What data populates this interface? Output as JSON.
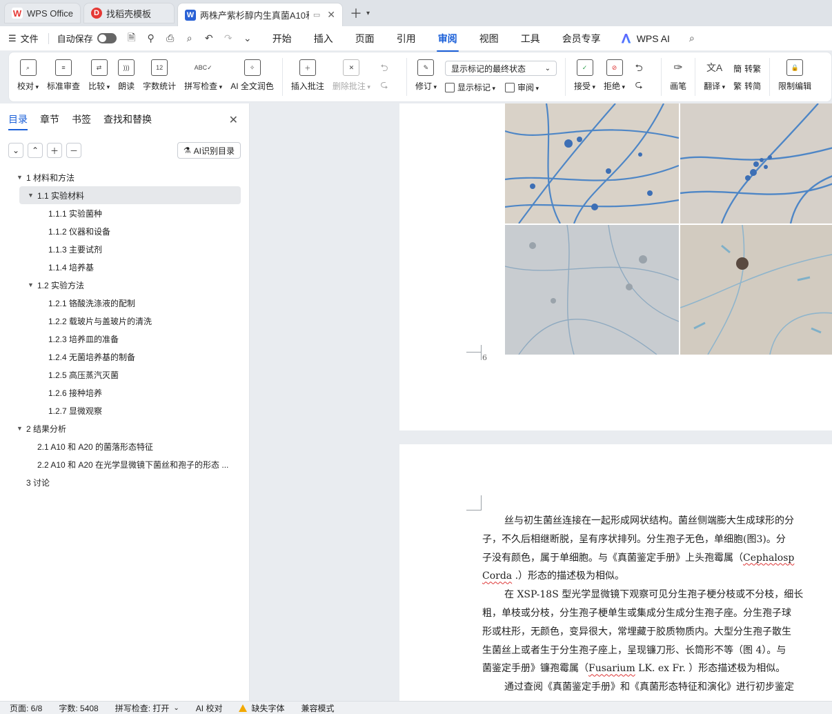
{
  "tabs": [
    {
      "label": "WPS Office",
      "icon": "wps-logo-icon",
      "color": "#e53935"
    },
    {
      "label": "找稻壳模板",
      "icon": "docer-icon",
      "color": "#e53935"
    },
    {
      "label": "两株产紫杉醇内生真菌A10和A",
      "icon": "word-doc-icon",
      "color": "#2a62d6",
      "active": true
    }
  ],
  "menubar": {
    "file": "文件",
    "autosave": "自动保存",
    "tabs": [
      "开始",
      "插入",
      "页面",
      "引用",
      "审阅",
      "视图",
      "工具",
      "会员专享"
    ],
    "active_tab": "审阅",
    "wps_ai": "WPS AI"
  },
  "ribbon": {
    "proof": "校对",
    "std_review": "标准审查",
    "compare": "比较",
    "read_aloud": "朗读",
    "word_count": "字数统计",
    "spell_check": "拼写检查",
    "ai_polish": "AI 全文润色",
    "insert_comment": "插入批注",
    "delete_comment": "删除批注",
    "track_changes": "修订",
    "display_state": "显示标记的最终状态",
    "show_markup": "显示标记",
    "review_pane": "审阅",
    "accept": "接受",
    "reject": "拒绝",
    "pen": "画笔",
    "translate": "翻译",
    "to_traditional": "转繁",
    "to_simplified": "转简",
    "restrict_edit": "限制编辑"
  },
  "nav": {
    "tabs": [
      "目录",
      "章节",
      "书签",
      "查找和替换"
    ],
    "active_tab": "目录",
    "ai_toc": "AI识别目录",
    "toc": [
      {
        "level": "l1",
        "text": "1 材料和方法",
        "caret": "▼"
      },
      {
        "level": "l2",
        "text": "1.1 实验材料",
        "caret": "▼",
        "selected": true
      },
      {
        "level": "l3",
        "text": "1.1.1 实验菌种"
      },
      {
        "level": "l3",
        "text": "1.1.2 仪器和设备"
      },
      {
        "level": "l3",
        "text": "1.1.3 主要试剂"
      },
      {
        "level": "l3",
        "text": "1.1.4 培养基"
      },
      {
        "level": "l2",
        "text": "1.2 实验方法",
        "caret": "▼"
      },
      {
        "level": "l3",
        "text": "1.2.1 铬酸洗涤液的配制"
      },
      {
        "level": "l3",
        "text": "1.2.2 载玻片与盖玻片的清洗"
      },
      {
        "level": "l3",
        "text": "1.2.3 培养皿的准备"
      },
      {
        "level": "l3",
        "text": "1.2.4 无菌培养基的制备"
      },
      {
        "level": "l3",
        "text": "1.2.5 高压蒸汽灭菌"
      },
      {
        "level": "l3",
        "text": "1.2.6 接种培养"
      },
      {
        "level": "l3",
        "text": "1.2.7 显微观察"
      },
      {
        "level": "l1",
        "text": "2 结果分析",
        "caret": "▼"
      },
      {
        "level": "l2n",
        "text": "2.1 A10 和 A20 的菌落形态特征"
      },
      {
        "level": "l2n",
        "text": "2.2 A10 和 A20 在光学显微镜下菌丝和孢子的形态 ..."
      },
      {
        "level": "l1n",
        "text": "3 讨论"
      }
    ]
  },
  "document": {
    "page_number": "6",
    "lines": [
      {
        "text": "丝与初生菌丝连接在一起形成网状结构。菌丝侧端膨大生成球形的分",
        "indent": true
      },
      {
        "text": "子，不久后相继断脱，呈有序状排列。分生孢子无色，单细胞(图3)。分"
      },
      {
        "text": "子没有颜色，属于单细胞。与《真菌鉴定手册》上头孢霉属（",
        "tail": "Cephalosp",
        "tail_squig": true
      },
      {
        "text": "",
        "head": "Corda",
        "head_squig": true,
        "rest": " .）形态的描述极为相似。"
      },
      {
        "text": "在 XSP-18S 型光学显微镜下观察可见分生孢子梗分枝或不分枝，细长",
        "indent": true
      },
      {
        "text": "粗，单枝或分枝，分生孢子梗单生或集成分生成分生孢子座。分生孢子球"
      },
      {
        "text": "形或柱形，无颜色，变异很大，常埋藏于胶质物质内。大型分生孢子散生"
      },
      {
        "text": "生菌丝上或者生于分生孢子座上，呈现镰刀形、长筒形不等（图 4）。与"
      },
      {
        "text": "菌鉴定手册》镰孢霉属（",
        "head": "Fusarium",
        "head_squig": true,
        "rest": " LK. ex Fr. ）形态描述极为相似。"
      },
      {
        "text": "通过查阅《真菌鉴定手册》和《真菌形态特征和演化》进行初步鉴定",
        "indent": true
      }
    ]
  },
  "status": {
    "page": "页面: 6/8",
    "words": "字数: 5408",
    "spell": "拼写检查: 打开",
    "ai_proof": "AI 校对",
    "missing_font": "缺失字体",
    "compat": "兼容模式"
  },
  "colors": {
    "accent": "#1a5fd8",
    "warning": "#f2a900"
  }
}
